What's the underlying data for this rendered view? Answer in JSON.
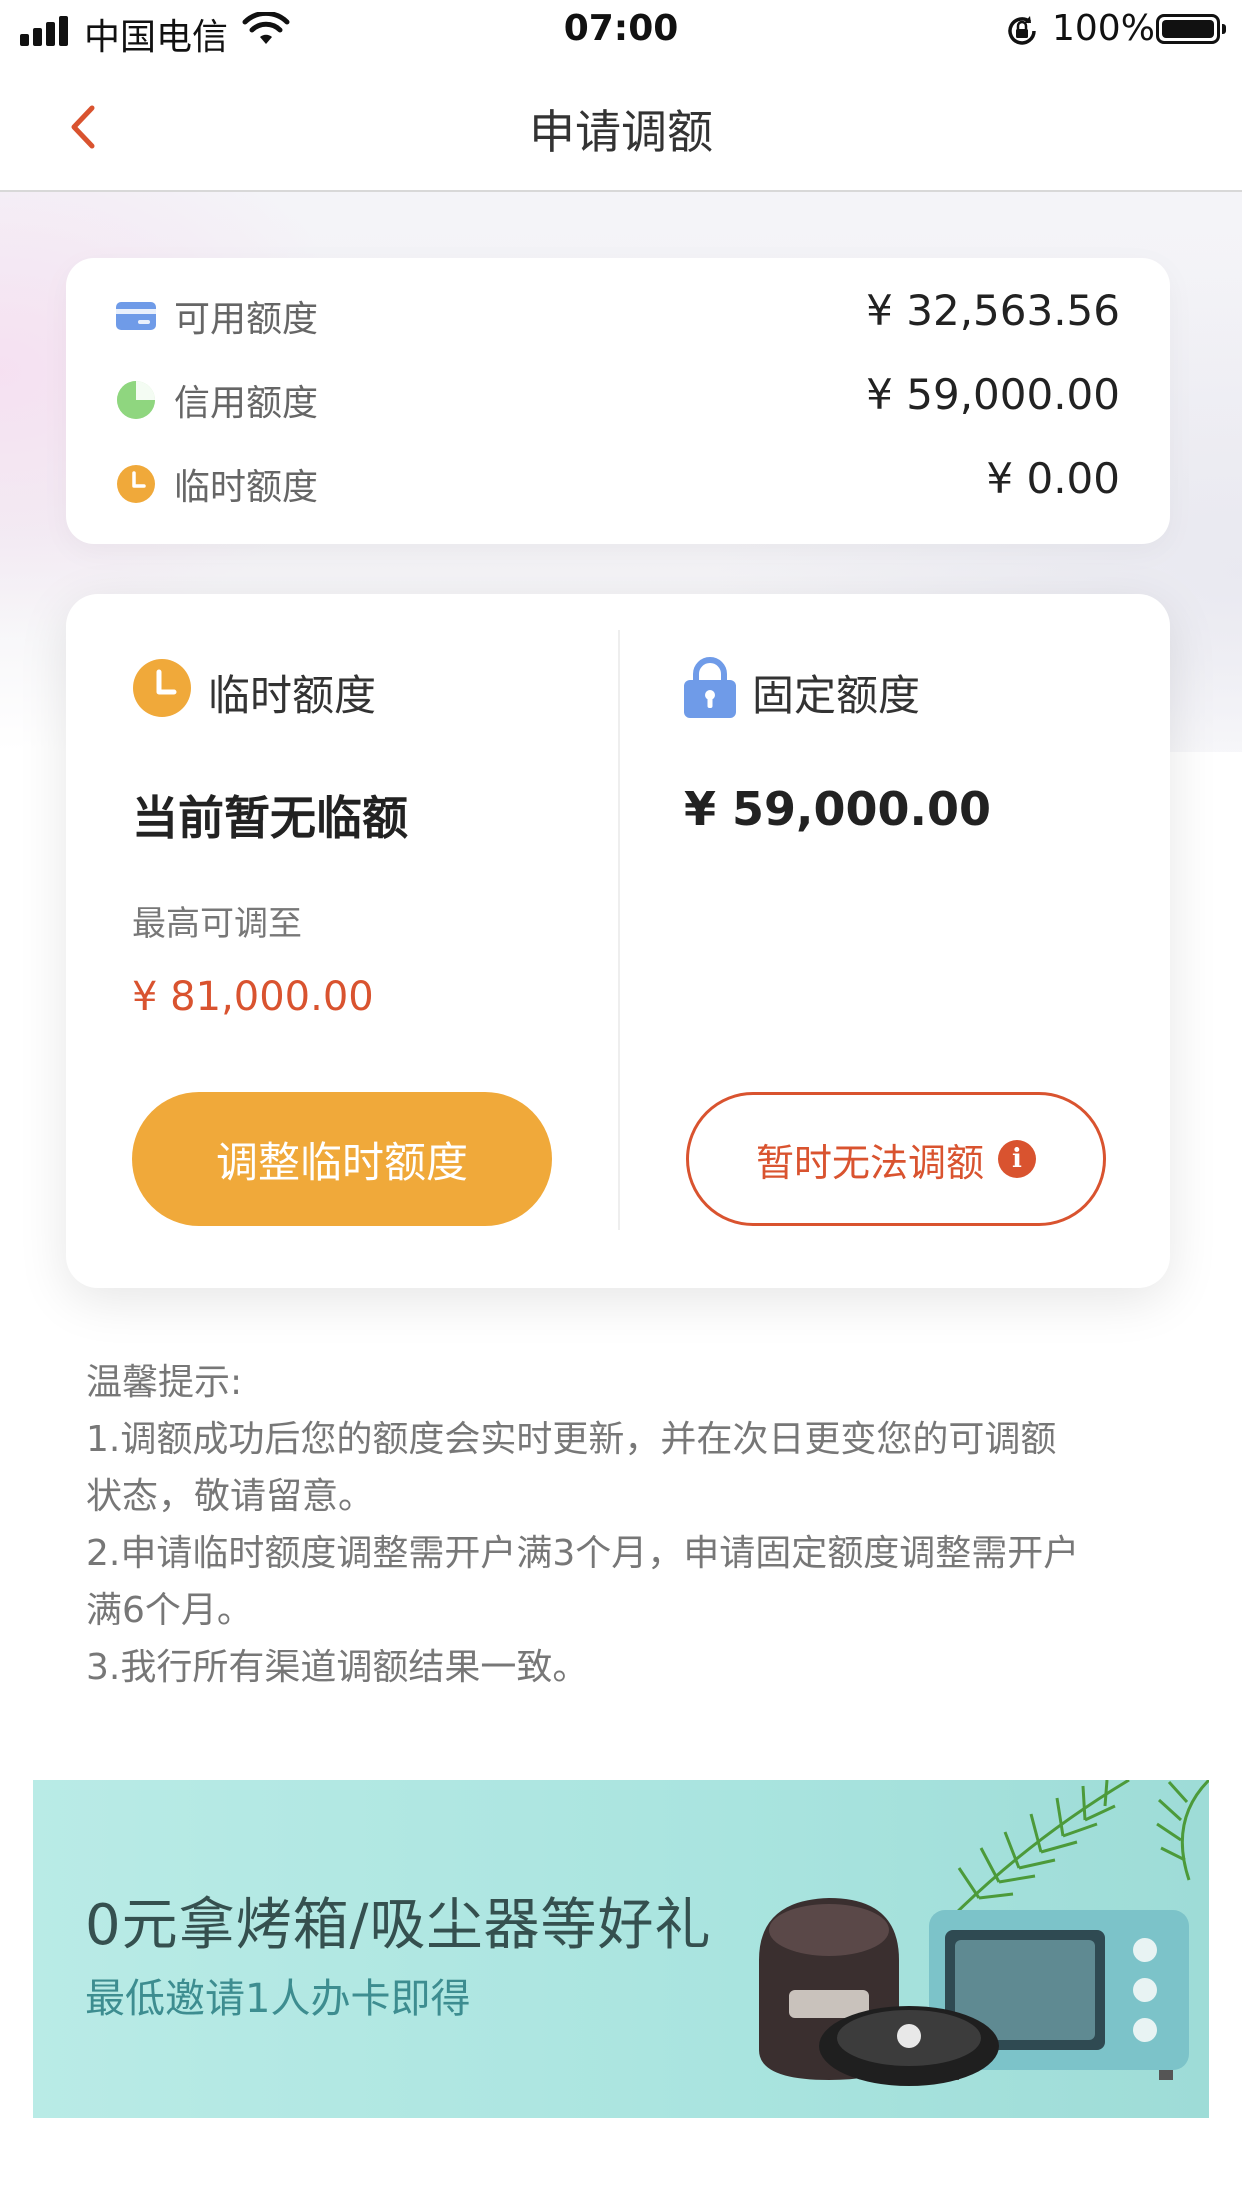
{
  "status_bar": {
    "carrier": "中国电信",
    "time": "07:00",
    "battery": "100%"
  },
  "nav": {
    "title": "申请调额"
  },
  "summary": {
    "items": [
      {
        "label": "可用额度",
        "value": "¥ 32,563.56",
        "icon": "card-icon",
        "color": "#6f9be8"
      },
      {
        "label": "信用额度",
        "value": "¥ 59,000.00",
        "icon": "pie-icon",
        "color": "#9ad98d"
      },
      {
        "label": "临时额度",
        "value": "¥ 0.00",
        "icon": "clock-icon",
        "color": "#f0a93a"
      }
    ]
  },
  "temp_limit": {
    "title": "临时额度",
    "status": "当前暂无临额",
    "max_label": "最高可调至",
    "max_value": "¥ 81,000.00",
    "button_label": "调整临时额度"
  },
  "fixed_limit": {
    "title": "固定额度",
    "amount": "¥ 59,000.00",
    "button_label": "暂时无法调额"
  },
  "tips": {
    "heading": "温馨提示:",
    "lines": [
      "1.调额成功后您的额度会实时更新，并在次日更变您的可调额",
      "状态，敬请留意。",
      "2.申请临时额度调整需开户满3个月，申请固定额度调整需开户",
      "满6个月。",
      "3.我行所有渠道调额结果一致。"
    ]
  },
  "banner": {
    "title": "0元拿烤箱/吸尘器等好礼",
    "subtitle": "最低邀请1人办卡即得"
  },
  "colors": {
    "accent_orange": "#f0a93a",
    "accent_red": "#d9532f",
    "banner_bg": "#b9ebe6"
  }
}
